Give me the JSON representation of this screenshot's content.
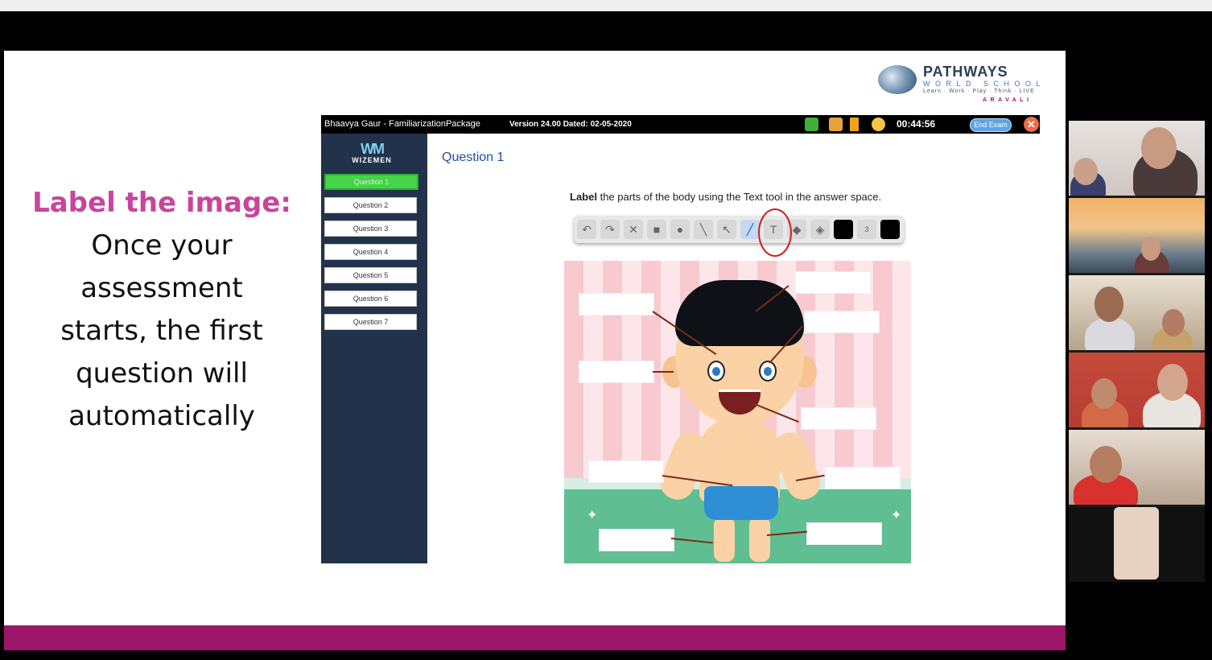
{
  "slide": {
    "heading": "Label the image:",
    "body_lines": [
      "Once your",
      "assessment",
      "starts, the first",
      "question will",
      "automatically"
    ]
  },
  "logo": {
    "title": "PATHWAYS",
    "subtitle": "WORLD SCHOOL",
    "tagline": "Learn · Work · Play · Think · LIVE",
    "place": "ARAVALI"
  },
  "app": {
    "window_title": "Bhaavya Gaur - FamiliarizationPackage",
    "version": "Version 24.00 Dated: 02-05-2020",
    "timer": "00:44:56",
    "end_exam_label": "End Exam",
    "close_icon": "close-icon",
    "brand": {
      "mark": "WM",
      "name": "WIZEMEN"
    },
    "questions": [
      {
        "label": "Question 1",
        "active": true
      },
      {
        "label": "Question 2",
        "active": false
      },
      {
        "label": "Question 3",
        "active": false
      },
      {
        "label": "Question 4",
        "active": false
      },
      {
        "label": "Question 5",
        "active": false
      },
      {
        "label": "Question 6",
        "active": false
      },
      {
        "label": "Question 7",
        "active": false
      }
    ],
    "question_heading": "Question 1",
    "instruction_bold": "Label",
    "instruction_rest": " the parts of the body using the Text tool in the answer space.",
    "toolbar_tools": [
      "undo-icon",
      "redo-icon",
      "delete-icon",
      "rectangle-icon",
      "ellipse-icon",
      "line-icon",
      "pointer-icon",
      "pen-icon",
      "text-tool-icon",
      "eraser-icon",
      "fill-icon",
      "color-swatch-icon",
      "stroke-size-icon",
      "color-swatch-icon"
    ],
    "text_tool_glyph": "T",
    "stroke_size_glyph": "3"
  },
  "colors": {
    "accent_pink": "#c9449b",
    "slide_bar": "#9b1668",
    "sidebar_bg": "#22324a",
    "active_question": "#47d34a",
    "question_heading": "#1f4fa0"
  }
}
